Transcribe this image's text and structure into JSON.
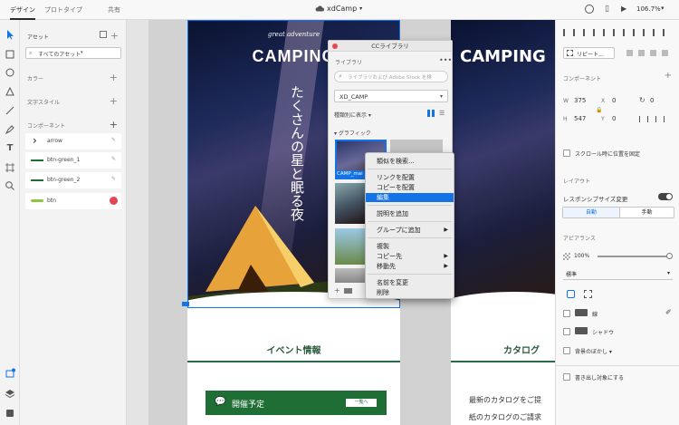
{
  "topbar": {
    "tabs": [
      "デザイン",
      "プロトタイプ",
      "共有"
    ],
    "doc_title": "xdCamp",
    "zoom": "106.7%"
  },
  "assets": {
    "title": "アセット",
    "filter": "すべてのアセット",
    "colors": "カラー",
    "textstyles": "文字スタイル",
    "components": "コンポーネント",
    "items": [
      {
        "name": "arrow"
      },
      {
        "name": "btn-green_1"
      },
      {
        "name": "btn-green_2"
      },
      {
        "name": "btn"
      }
    ]
  },
  "canvas": {
    "left_artboard": {
      "script": "great adventure",
      "camping": "CAMPING",
      "vertical": "たくさんの星と眠る夜",
      "section_title": "イベント情報",
      "button_label": "開催予定",
      "more": "一覧へ"
    },
    "right_artboard": {
      "camping": "CAMPING",
      "section_title": "カタログ",
      "body1": "最新のカタログをご提",
      "body2": "紙のカタログのご請求"
    }
  },
  "library": {
    "title": "CCライブラリ",
    "subtitle": "ライブラリ",
    "search_placeholder": "ライブラリおよび Adobe Stock を検",
    "selected_library": "XD_CAMP",
    "view_label": "種類別に表示",
    "graphics_label": "グラフィック",
    "thumb_caption": "CAMP_mai"
  },
  "context_menu": {
    "items": [
      {
        "label": "類似を検索..."
      },
      {
        "label": "リンクを配置"
      },
      {
        "label": "コピーを配置"
      },
      {
        "label": "編集"
      },
      {
        "label": "説明を追加"
      },
      {
        "label": "グループに追加"
      },
      {
        "label": "複製"
      },
      {
        "label": "コピー先"
      },
      {
        "label": "移動先"
      },
      {
        "label": "名前を変更"
      },
      {
        "label": "削除"
      }
    ],
    "highlighted": "編集"
  },
  "props": {
    "repeat_grid": "リピート...",
    "component": "コンポーネント",
    "w_label": "W",
    "w": "375",
    "x_label": "X",
    "x": "0",
    "rot": "0",
    "h_label": "H",
    "h": "547",
    "y_label": "Y",
    "y": "0",
    "fix_scroll": "スクロール時に位置を固定",
    "layout": "レイアウト",
    "responsive": "レスポンシブサイズ変更",
    "auto": "自動",
    "manual": "手動",
    "appearance": "アピアランス",
    "opacity": "100%",
    "blend": "標準",
    "fill": "線",
    "shadow": "シャドウ",
    "bg_blur": "背景のぼかし",
    "export": "書き出し対象にする",
    "accent": "#1473e6"
  }
}
